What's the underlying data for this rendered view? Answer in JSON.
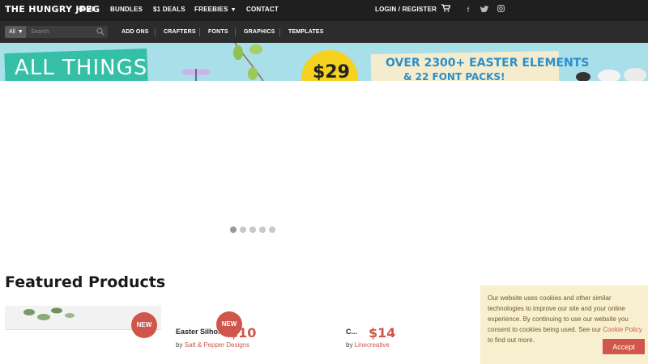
{
  "header": {
    "logo": "THE HUNGRY JPEG",
    "nav": [
      {
        "label": "HOME"
      },
      {
        "label": "BUNDLES"
      },
      {
        "label": "$1 DEALS"
      },
      {
        "label": "FREEBIES"
      },
      {
        "label": "CONTACT"
      }
    ],
    "login_label": "LOGIN / REGISTER",
    "icons": [
      "cart-icon",
      "facebook-icon",
      "twitter-icon",
      "instagram-icon"
    ]
  },
  "subbar": {
    "search_category": "All",
    "search_placeholder": "Search",
    "nav": [
      {
        "label": "ADD ONS"
      },
      {
        "label": "CRAFTERS"
      },
      {
        "label": "FONTS"
      },
      {
        "label": "GRAPHICS"
      },
      {
        "label": "TEMPLATES"
      }
    ]
  },
  "banner": {
    "sign_text": "ALL THINGS",
    "price": "$29",
    "promo_line1": "OVER 2300+ EASTER ELEMENTS",
    "promo_line2": "& 22 FONT PACKS!"
  },
  "slider": {
    "dot_count": 5,
    "active_index": 0
  },
  "featured": {
    "title": "Featured Products",
    "products": [
      {
        "badge": "NEW"
      },
      {
        "badge": "NEW",
        "name": "Easter Silho...",
        "price": "$10",
        "by_prefix": "by",
        "by": "Salt & Pepper Designs"
      },
      {
        "name": "C...",
        "price": "$14",
        "by_prefix": "by",
        "by": "Linecreative"
      }
    ]
  },
  "cookie": {
    "text_before": "Our website uses cookies and other similar technologies to improve our site and your online experience. By continuing to use our website you consent to cookies being used. See our ",
    "link": "Cookie Policy",
    "text_after": " to find out more.",
    "accept": "Accept"
  },
  "colors": {
    "accent": "#d0564b",
    "dark": "#1f1f1f",
    "banner": "#a9dfe8",
    "cookie_bg": "#f8efcf"
  }
}
